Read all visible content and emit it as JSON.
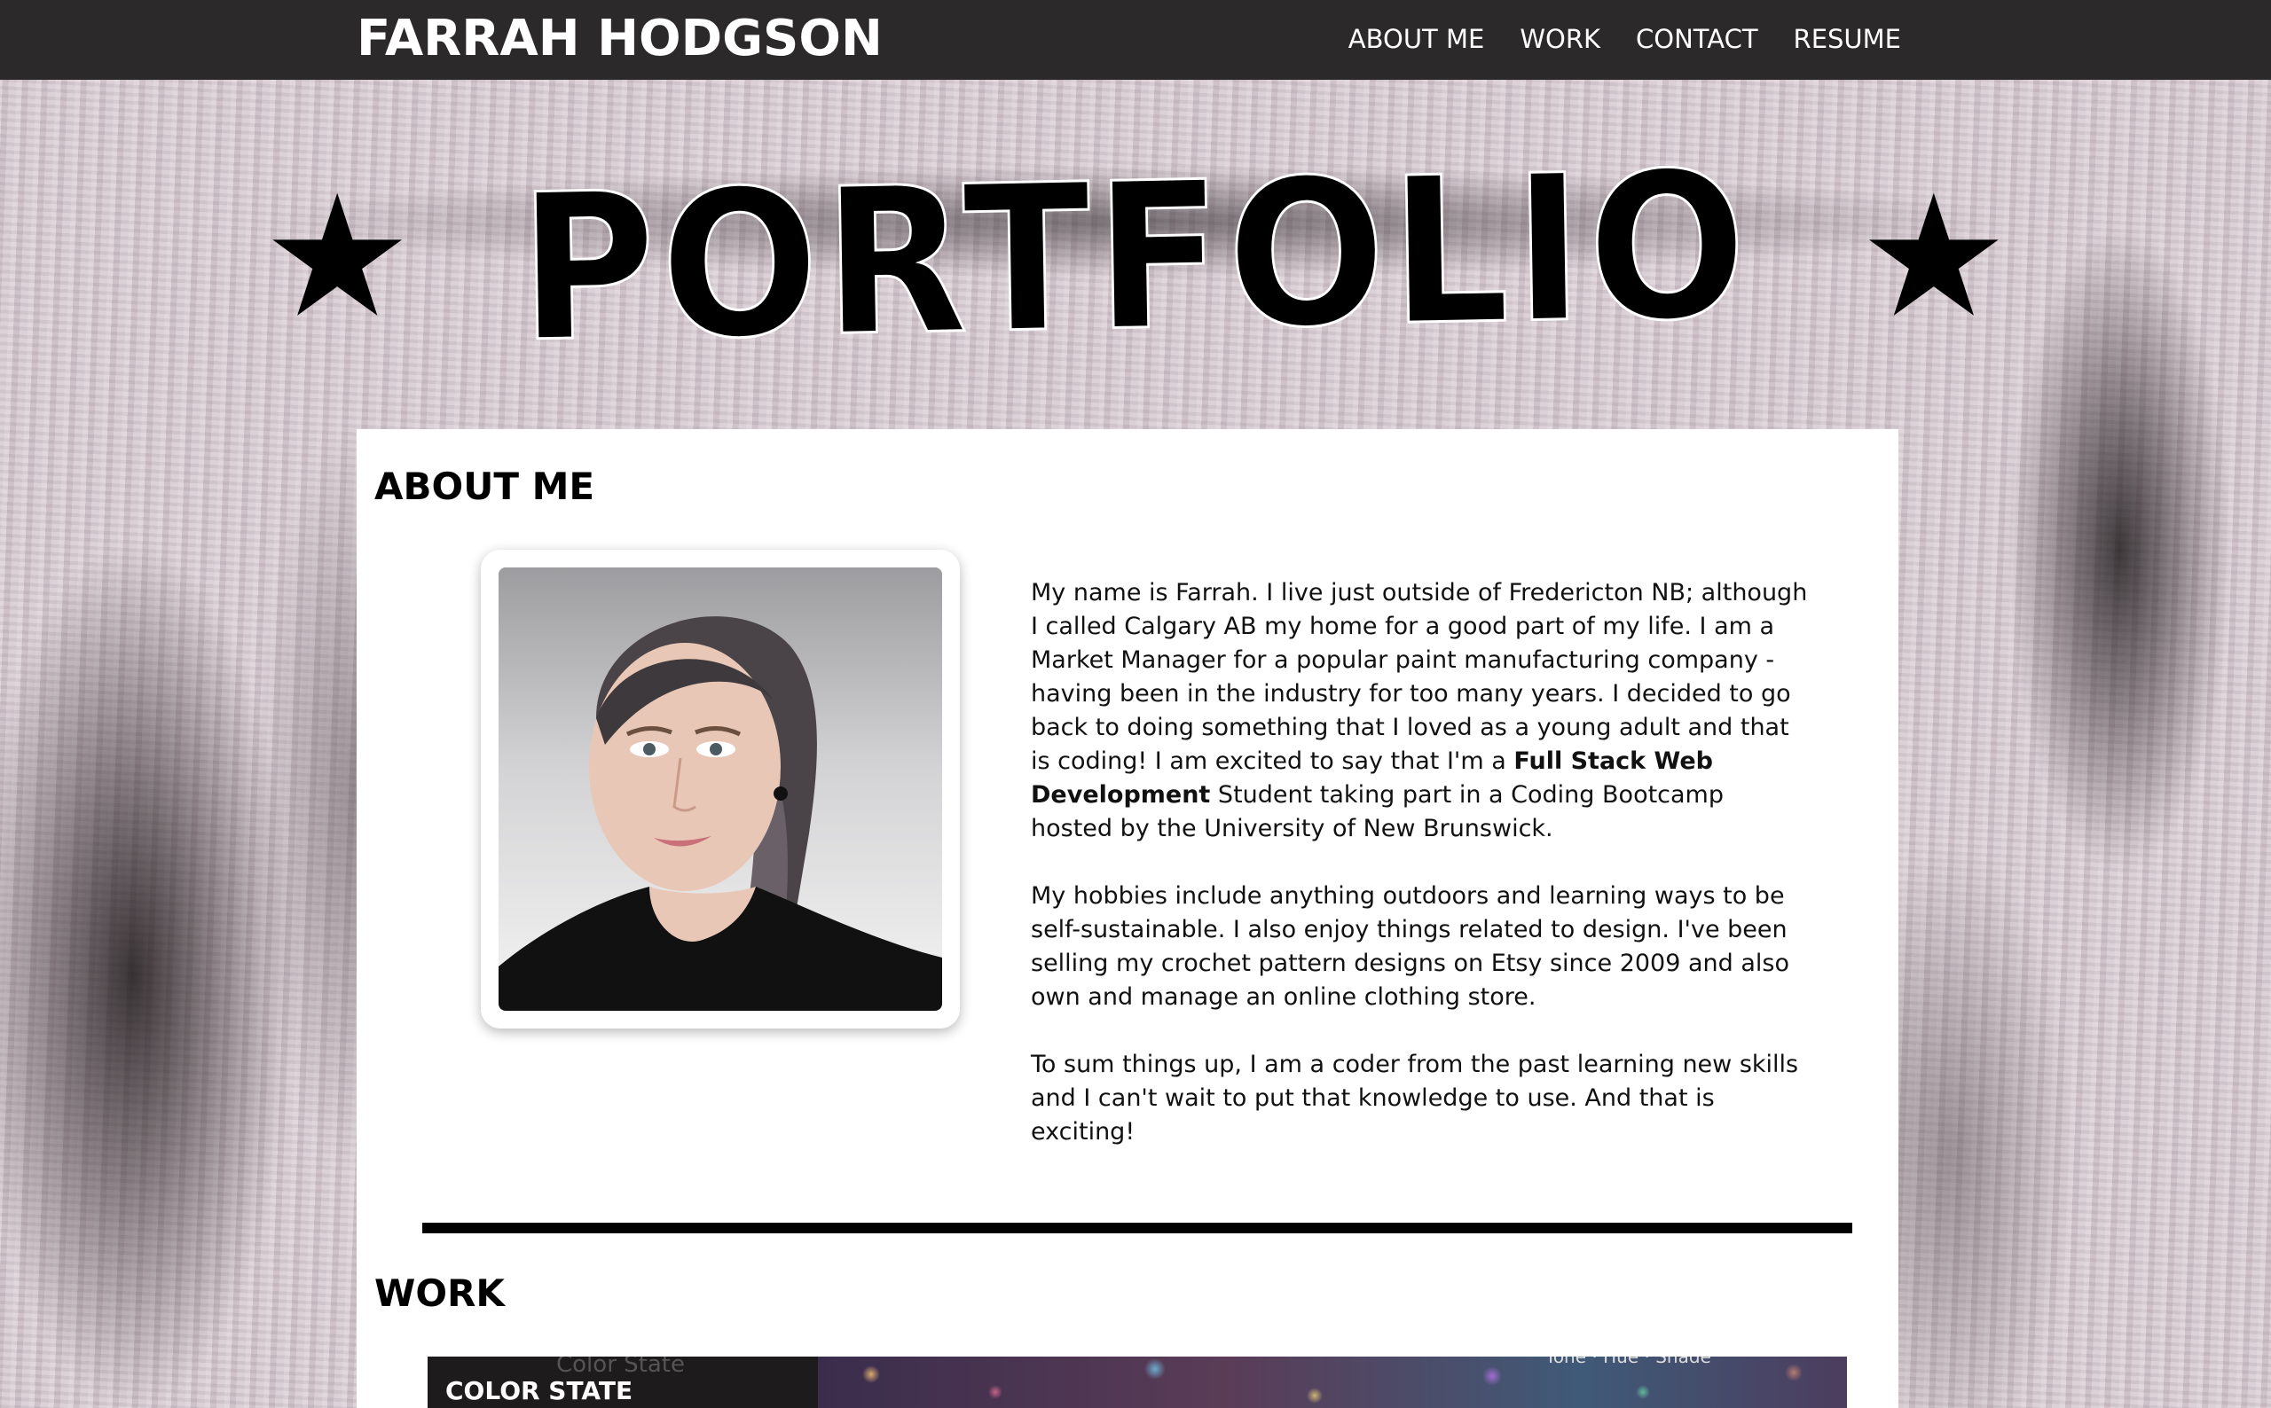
{
  "header": {
    "brand": "FARRAH HODGSON",
    "nav": [
      {
        "label": "ABOUT ME"
      },
      {
        "label": "WORK"
      },
      {
        "label": "CONTACT"
      },
      {
        "label": "RESUME"
      }
    ]
  },
  "hero": {
    "star_left": "★",
    "title": "PORTFOLIO",
    "star_right": "★"
  },
  "about": {
    "title": "ABOUT ME",
    "photo_alt": "Portrait of Farrah Hodgson",
    "p1_before": "My name is Farrah. I live just outside of Fredericton NB; although I called Calgary AB my home for a good part of my life. I am a Market Manager for a popular paint manufacturing company - having been in the industry for too many years. I decided to go back to doing something that I loved as a young adult and that is coding! I am excited to say that I'm a ",
    "p1_bold": "Full Stack Web Development",
    "p1_after": " Student taking part in a Coding Bootcamp hosted by the University of New Brunswick.",
    "p2": "My hobbies include anything outdoors and learning ways to be self-sustainable. I also enjoy things related to design. I've been selling my crochet pattern designs on Etsy since 2009 and also own and manage an online clothing store.",
    "p3": "To sum things up, I am a coder from the past learning new skills and I can't wait to put that knowledge to use. And that is exciting!"
  },
  "work": {
    "title": "WORK",
    "projects": [
      {
        "label": "COLOR STATE",
        "ghost_text": "Color State",
        "ghost_text_right": "Tone · Hue · Shade"
      }
    ]
  },
  "colors": {
    "header_bg": "#2b292a",
    "card_bg": "#ffffff",
    "text": "#000000"
  }
}
